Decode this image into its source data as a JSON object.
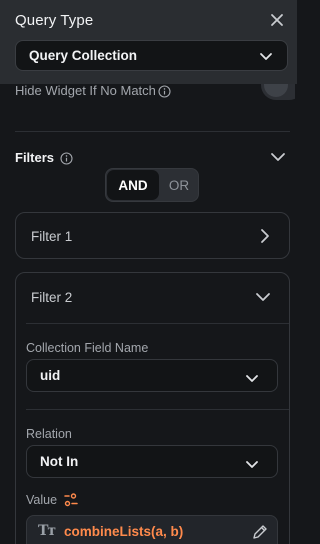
{
  "header": {
    "title": "Query Type",
    "query_select": "Query Collection"
  },
  "hide_widget": {
    "label": "Hide Widget If No Match",
    "enabled": false
  },
  "filters": {
    "label": "Filters",
    "logic": {
      "and_label": "AND",
      "or_label": "OR",
      "selected": "AND"
    },
    "items": [
      {
        "title": "Filter 1",
        "expanded": false
      },
      {
        "title": "Filter 2",
        "expanded": true,
        "collection_field_label": "Collection Field Name",
        "collection_field_value": "uid",
        "relation_label": "Relation",
        "relation_value": "Not In",
        "value_label": "Value",
        "value_expression": "combineLists(a, b)"
      }
    ]
  },
  "colors": {
    "background": "#15171a",
    "header": "#2a2d31",
    "accent": "#ff8a4c",
    "text": "#f2f3f5",
    "muted": "#a3a7ad"
  },
  "icons": [
    "close-icon",
    "chevron-down-icon",
    "info-icon",
    "chevron-right-icon",
    "variable-icon",
    "text-type-icon",
    "edit-icon"
  ]
}
